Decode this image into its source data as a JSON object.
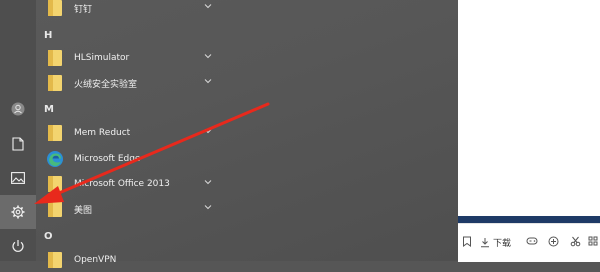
{
  "rail": {
    "items": [
      {
        "icon": "user-icon"
      },
      {
        "icon": "document-icon"
      },
      {
        "icon": "pictures-icon"
      },
      {
        "icon": "settings-gear-icon",
        "active": true
      },
      {
        "icon": "power-icon"
      }
    ]
  },
  "app_list": {
    "top_item": {
      "label": "钉钉",
      "icon": "folder-icon",
      "expandable": true
    },
    "groups": [
      {
        "letter": "H",
        "items": [
          {
            "label": "HLSimulator",
            "icon": "folder-icon",
            "expandable": true
          },
          {
            "label": "火绒安全实验室",
            "icon": "folder-icon",
            "expandable": true
          }
        ]
      },
      {
        "letter": "M",
        "items": [
          {
            "label": "Mem Reduct",
            "icon": "folder-icon",
            "expandable": true
          },
          {
            "label": "Microsoft Edge",
            "icon": "edge-icon",
            "expandable": false
          },
          {
            "label": "Microsoft Office 2013",
            "icon": "folder-icon",
            "expandable": true
          },
          {
            "label": "美图",
            "icon": "folder-icon",
            "expandable": true
          }
        ]
      },
      {
        "letter": "O",
        "items": [
          {
            "label": "OpenVPN",
            "icon": "folder-icon",
            "expandable": false
          }
        ]
      }
    ]
  },
  "toolbar": {
    "download_label": "下载"
  },
  "colors": {
    "annotation_arrow": "#e8291c",
    "folder": "#f3d46f",
    "edge": "#2b8fd6",
    "bluebar": "#1e3a66"
  }
}
